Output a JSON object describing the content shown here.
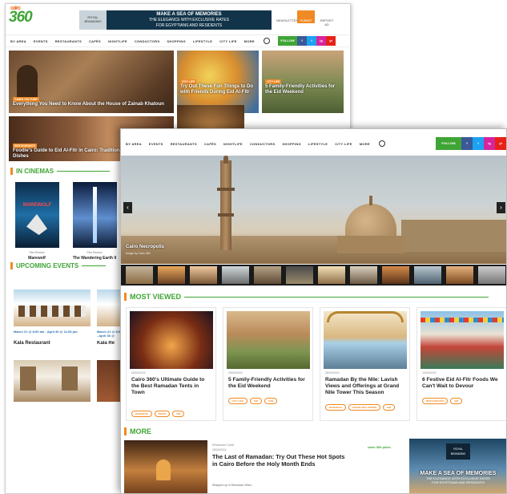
{
  "site": {
    "logo_prefix": "cairo",
    "logo_text": "360"
  },
  "back": {
    "banner": {
      "brand": "ROYAL BRANDING",
      "lines": [
        "MAKE A SEA OF MEMORIES",
        "THE ELEGANCE WITH EXCLUSIVE RATES",
        "FOR EGYPTIANS AND RESIDENTS"
      ]
    },
    "header_actions": [
      "NEWSLETTER",
      "SUBMIT",
      "REPORT AD"
    ],
    "nav": [
      "BY AREA",
      "EVENTS",
      "RESTAURANTS",
      "CAFÉS",
      "NIGHTLIFE",
      "CONDUCTORS",
      "SHOPPING",
      "LIFESTYLE",
      "CITY LIFE",
      "MORE"
    ],
    "follow_label": "FOLLOW",
    "social": [
      "f",
      "t",
      "ig",
      "yt"
    ],
    "tiles": [
      {
        "tag": "CAIRO CULTURE",
        "title": "Everything You Need to Know About the House of Zainab Khatoun"
      },
      {
        "tag": "CITY LIFE",
        "title": "Try Out These Fun Things to Do with Friends During Eid Al-Fitr"
      },
      {
        "tag": "CITY LIFE",
        "title": "5 Family-Friendly Activities for the Eid Weekend"
      },
      {
        "tag": "RESTAURANTS",
        "title": "Foodie's Guide to Eid Al-Fitr in Cairo: Traditional and Must-Try Dishes"
      }
    ],
    "in_cinemas": {
      "heading": "IN CINEMAS",
      "films": [
        {
          "poster": "MAREWOLF",
          "sub": "Film Review",
          "title": "Marewolf"
        },
        {
          "poster": "",
          "sub": "Film Review",
          "title": "The Wandering Earth II"
        }
      ]
    },
    "upcoming_events": {
      "heading": "UPCOMING EVENTS",
      "events": [
        {
          "date": "March 21 @ 8:00 am - April 30 @ 11:00 pm",
          "name": "Kala Restaurant"
        },
        {
          "date": "March 21 @ 8:00 am - April 30 @",
          "name": "Kala Re"
        }
      ]
    }
  },
  "front": {
    "nav": [
      "BY AREA",
      "EVENTS",
      "RESTAURANTS",
      "CAFÉS",
      "NIGHTLIFE",
      "CONDUCTORS",
      "SHOPPING",
      "LIFESTYLE",
      "CITY LIFE",
      "MORE"
    ],
    "follow_label": "FOLLOW",
    "social": [
      "f",
      "t",
      "ig",
      "yt"
    ],
    "hero": {
      "caption": "Cairo Necropolis",
      "sub": "Image by Cairo 360",
      "prev": "‹",
      "next": "›"
    },
    "most_viewed": {
      "heading": "MOST VIEWED",
      "cards": [
        {
          "date": "28/03/2024",
          "title": "Cairo 360's Ultimate Guide to the Best Ramadan Tents in Town",
          "pills": [
            "RAMADAN",
            "TENTS",
            "EID"
          ]
        },
        {
          "date": "28/03/2024",
          "title": "5 Family-Friendly Activities for the Eid Weekend",
          "pills": [
            "CITY LIFE",
            "EID",
            "FUN"
          ]
        },
        {
          "date": "26/03/2024",
          "title": "Ramadan By the Nile: Lavish Views and Offerings at Grand Nile Tower This Season",
          "pills": [
            "RAMADAN",
            "GRAND NILE TOWER",
            "EID"
          ]
        },
        {
          "date": "19/03/2024",
          "title": "6 Festive Eid Al-Fitr Foods We Can't Wait to Devour",
          "pills": [
            "RESTAURANTS",
            "EID"
          ]
        }
      ]
    },
    "more": {
      "heading": "MORE",
      "tag": "Restaurant Guide",
      "date": "18/03/2024",
      "title": "The Last of Ramadan: Try Out These Hot Spots in Cairo Before the Holy Month Ends",
      "excerpt": "Wrapped up in Ramadan Vibes...",
      "brand_badge": "cairo 360 picks"
    },
    "ad": {
      "brand": "ROYAL BRANDING",
      "headline": "MAKE A SEA OF MEMORIES",
      "line2": "THE ELEGANCE WITH EXCLUSIVE RATES",
      "line3": "FOR EGYPTIANS AND RESIDENTS"
    }
  }
}
